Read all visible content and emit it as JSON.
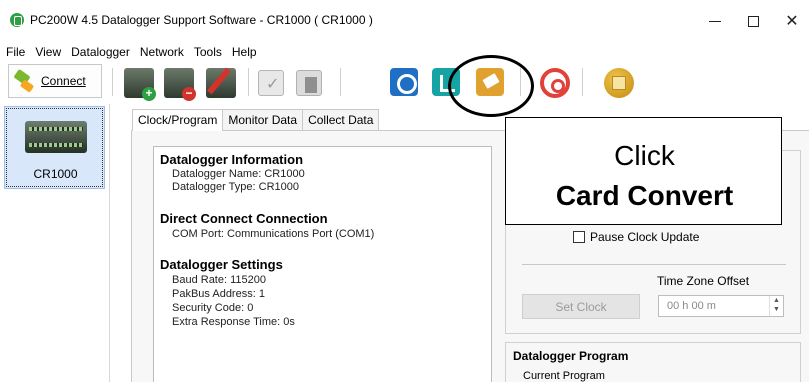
{
  "window": {
    "title": "PC200W 4.5 Datalogger Support Software - CR1000 ( CR1000 )",
    "minimize": "—",
    "maximize": "☐",
    "close": "✕"
  },
  "menu": [
    "File",
    "View",
    "Datalogger",
    "Network",
    "Tools",
    "Help"
  ],
  "toolbar": {
    "connect_label": "Connect",
    "icons": [
      "add-datalogger-icon",
      "delete-datalogger-icon",
      "edit-datalogger-icon",
      "check-icon",
      "copy-icon",
      "network-icon",
      "short-cut-icon",
      "card-convert-icon",
      "stop-icon",
      "cube-icon"
    ]
  },
  "devices": [
    {
      "label": "CR1000"
    }
  ],
  "tabs": [
    "Clock/Program",
    "Monitor Data",
    "Collect Data"
  ],
  "info": {
    "sections": [
      {
        "title": "Datalogger Information",
        "lines": [
          "Datalogger Name: CR1000",
          "Datalogger Type: CR1000"
        ]
      },
      {
        "title": "Direct Connect Connection",
        "lines": [
          "COM Port: Communications Port (COM1)"
        ]
      },
      {
        "title": "Datalogger Settings",
        "lines": [
          "Baud Rate: 115200",
          "PakBus Address: 1",
          "Security Code: 0",
          "Extra Response Time: 0s"
        ]
      }
    ]
  },
  "clock": {
    "pause_label": "Pause Clock Update",
    "tz_label": "Time Zone Offset",
    "set_clock_label": "Set Clock",
    "tz_value": "00 h 00 m"
  },
  "program": {
    "title": "Datalogger Program",
    "current": "Current Program"
  },
  "callout": {
    "line1": "Click",
    "line2": "Card Convert"
  },
  "colors": {
    "selected_tile": "#d9e7fb",
    "card_convert": "#e1a12e",
    "stop": "#e0423a",
    "network": "#1f6fc4"
  }
}
